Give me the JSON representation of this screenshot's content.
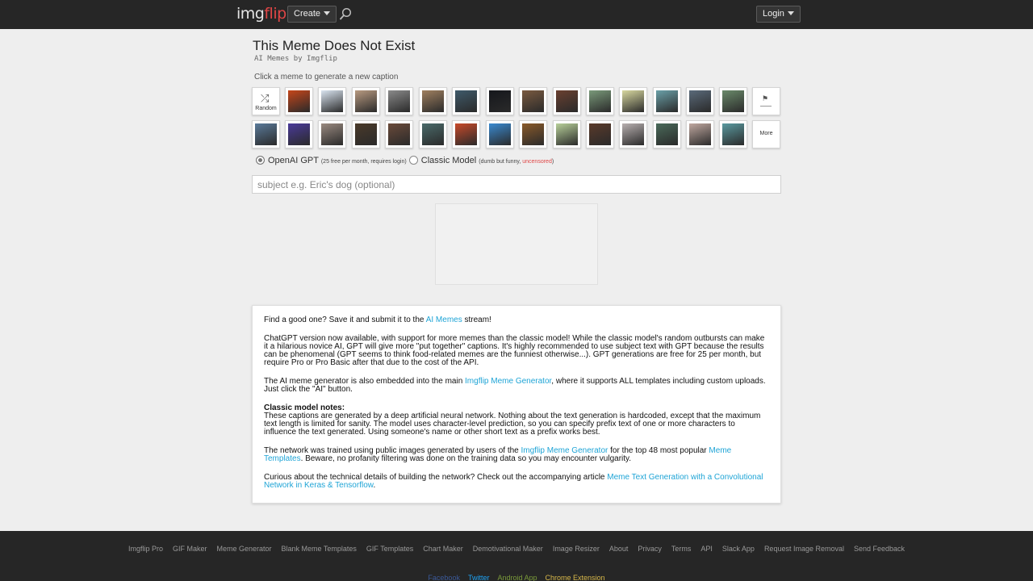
{
  "header": {
    "logo_part1": "img",
    "logo_part2": "flip",
    "create_label": "Create",
    "login_label": "Login"
  },
  "main": {
    "title": "This Meme Does Not Exist",
    "subtitle": "AI Memes by Imgflip",
    "instructions": "Click a meme to generate a new caption",
    "random_label": "Random",
    "more_label": "More",
    "row1_thumbs": [
      "#c5461a",
      "#d9e4f0",
      "#b89a80",
      "#8a8a8a",
      "#a08060",
      "#3f5a6a",
      "#15171c",
      "#7a5a40",
      "#6a4030",
      "#7a9a7a",
      "#d8d8a0",
      "#6aa0a8",
      "#5a6a7a",
      "#6a8a6a"
    ],
    "row2_thumbs": [
      "#5a7a9a",
      "#4a3a9a",
      "#9a8a80",
      "#4a3a2a",
      "#6a4a3a",
      "#4a6a6a",
      "#c84a2a",
      "#3a8ad0",
      "#8a5a2a",
      "#b8d09a",
      "#5a3a2a",
      "#b8b0b0",
      "#4a6a5a",
      "#c0a8a0",
      "#5a9aa0"
    ]
  },
  "model": {
    "option1_label": "OpenAI GPT",
    "option1_note": "(25 free per month, requires login)",
    "option2_label": "Classic Model",
    "option2_note_pre": "(dumb but funny, ",
    "option2_note_warn": "uncensored",
    "option2_note_post": ")"
  },
  "subject": {
    "placeholder": "subject e.g. Eric's dog (optional)"
  },
  "info": {
    "p1_pre": "Find a good one? Save it and submit it to the ",
    "p1_link": "AI Memes",
    "p1_post": " stream!",
    "p2": "ChatGPT version now available, with support for more memes than the classic model! While the classic model's random outbursts can make it a hilarious novice AI, GPT will give more \"put together\" captions. It's highly recommended to use subject text with GPT because the results can be phenomenal (GPT seems to think food-related memes are the funniest otherwise...). GPT generations are free for 25 per month, but require Pro or Pro Basic after that due to the cost of the API.",
    "p3_pre": "The AI meme generator is also embedded into the main ",
    "p3_link": "Imgflip Meme Generator",
    "p3_post": ", where it supports ALL templates including custom uploads. Just click the \"AI\" button.",
    "p4_heading": "Classic model notes:",
    "p4_body": "These captions are generated by a deep artificial neural network. Nothing about the text generation is hardcoded, except that the maximum text length is limited for sanity. The model uses character-level prediction, so you can specify prefix text of one or more characters to influence the text generated. Using someone's name or other short text as a prefix works best.",
    "p5_pre": "The network was trained using public images generated by users of the ",
    "p5_link1": "Imgflip Meme Generator",
    "p5_mid": " for the top 48 most popular ",
    "p5_link2": "Meme Templates",
    "p5_post": ". Beware, no profanity filtering was done on the training data so you may encounter vulgarity.",
    "p6_pre": "Curious about the technical details of building the network? Check out the accompanying article ",
    "p6_link": "Meme Text Generation with a Convolutional Network in Keras & Tensorflow",
    "p6_post": "."
  },
  "footer": {
    "links": [
      "Imgflip Pro",
      "GIF Maker",
      "Meme Generator",
      "Blank Meme Templates",
      "GIF Templates",
      "Chart Maker",
      "Demotivational Maker",
      "Image Resizer",
      "About",
      "Privacy",
      "Terms",
      "API",
      "Slack App",
      "Request Image Removal",
      "Send Feedback"
    ],
    "social": [
      {
        "label": "Facebook",
        "color": "#3b5998"
      },
      {
        "label": "Twitter",
        "color": "#1da1f2"
      },
      {
        "label": "Android App",
        "color": "#7a9a3a"
      },
      {
        "label": "Chrome Extension",
        "color": "#d8b84a"
      }
    ]
  },
  "colors": {
    "accent_link": "#1ea4d6",
    "warning": "#e04646",
    "header_bg": "#262626"
  }
}
